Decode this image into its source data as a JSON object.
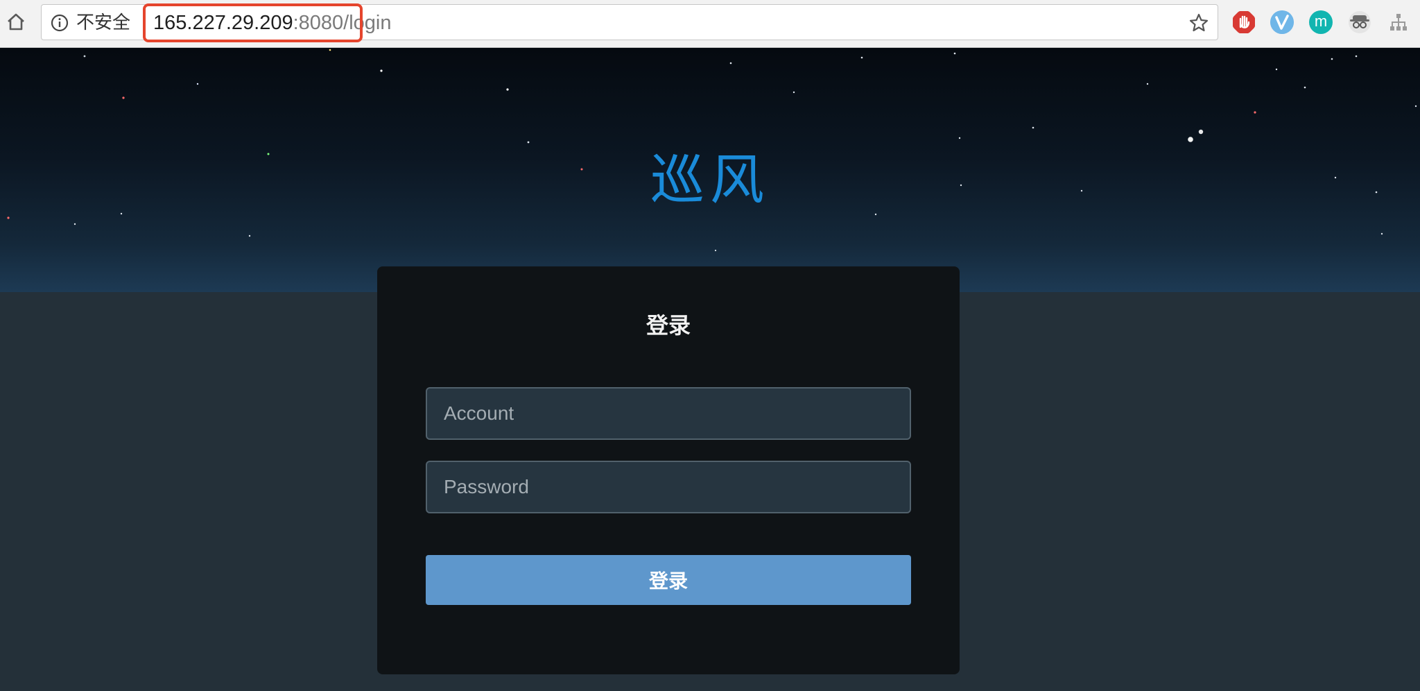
{
  "browser": {
    "security_label": "不安全",
    "url_host": "165.227.29.209",
    "url_port": ":8080",
    "url_path": "/login",
    "extensions": [
      "adblock-icon",
      "vimium-icon",
      "m-extension-icon",
      "spy-icon",
      "sitemap-icon"
    ],
    "ext_m_label": "m"
  },
  "page": {
    "brand": "巡风",
    "login_title": "登录",
    "account_placeholder": "Account",
    "password_placeholder": "Password",
    "submit_label": "登录"
  },
  "colors": {
    "brand": "#1a8bd9",
    "button": "#5e97cc",
    "card_bg": "#0f1316",
    "page_bg": "#243039",
    "url_highlight": "#e5452d"
  }
}
